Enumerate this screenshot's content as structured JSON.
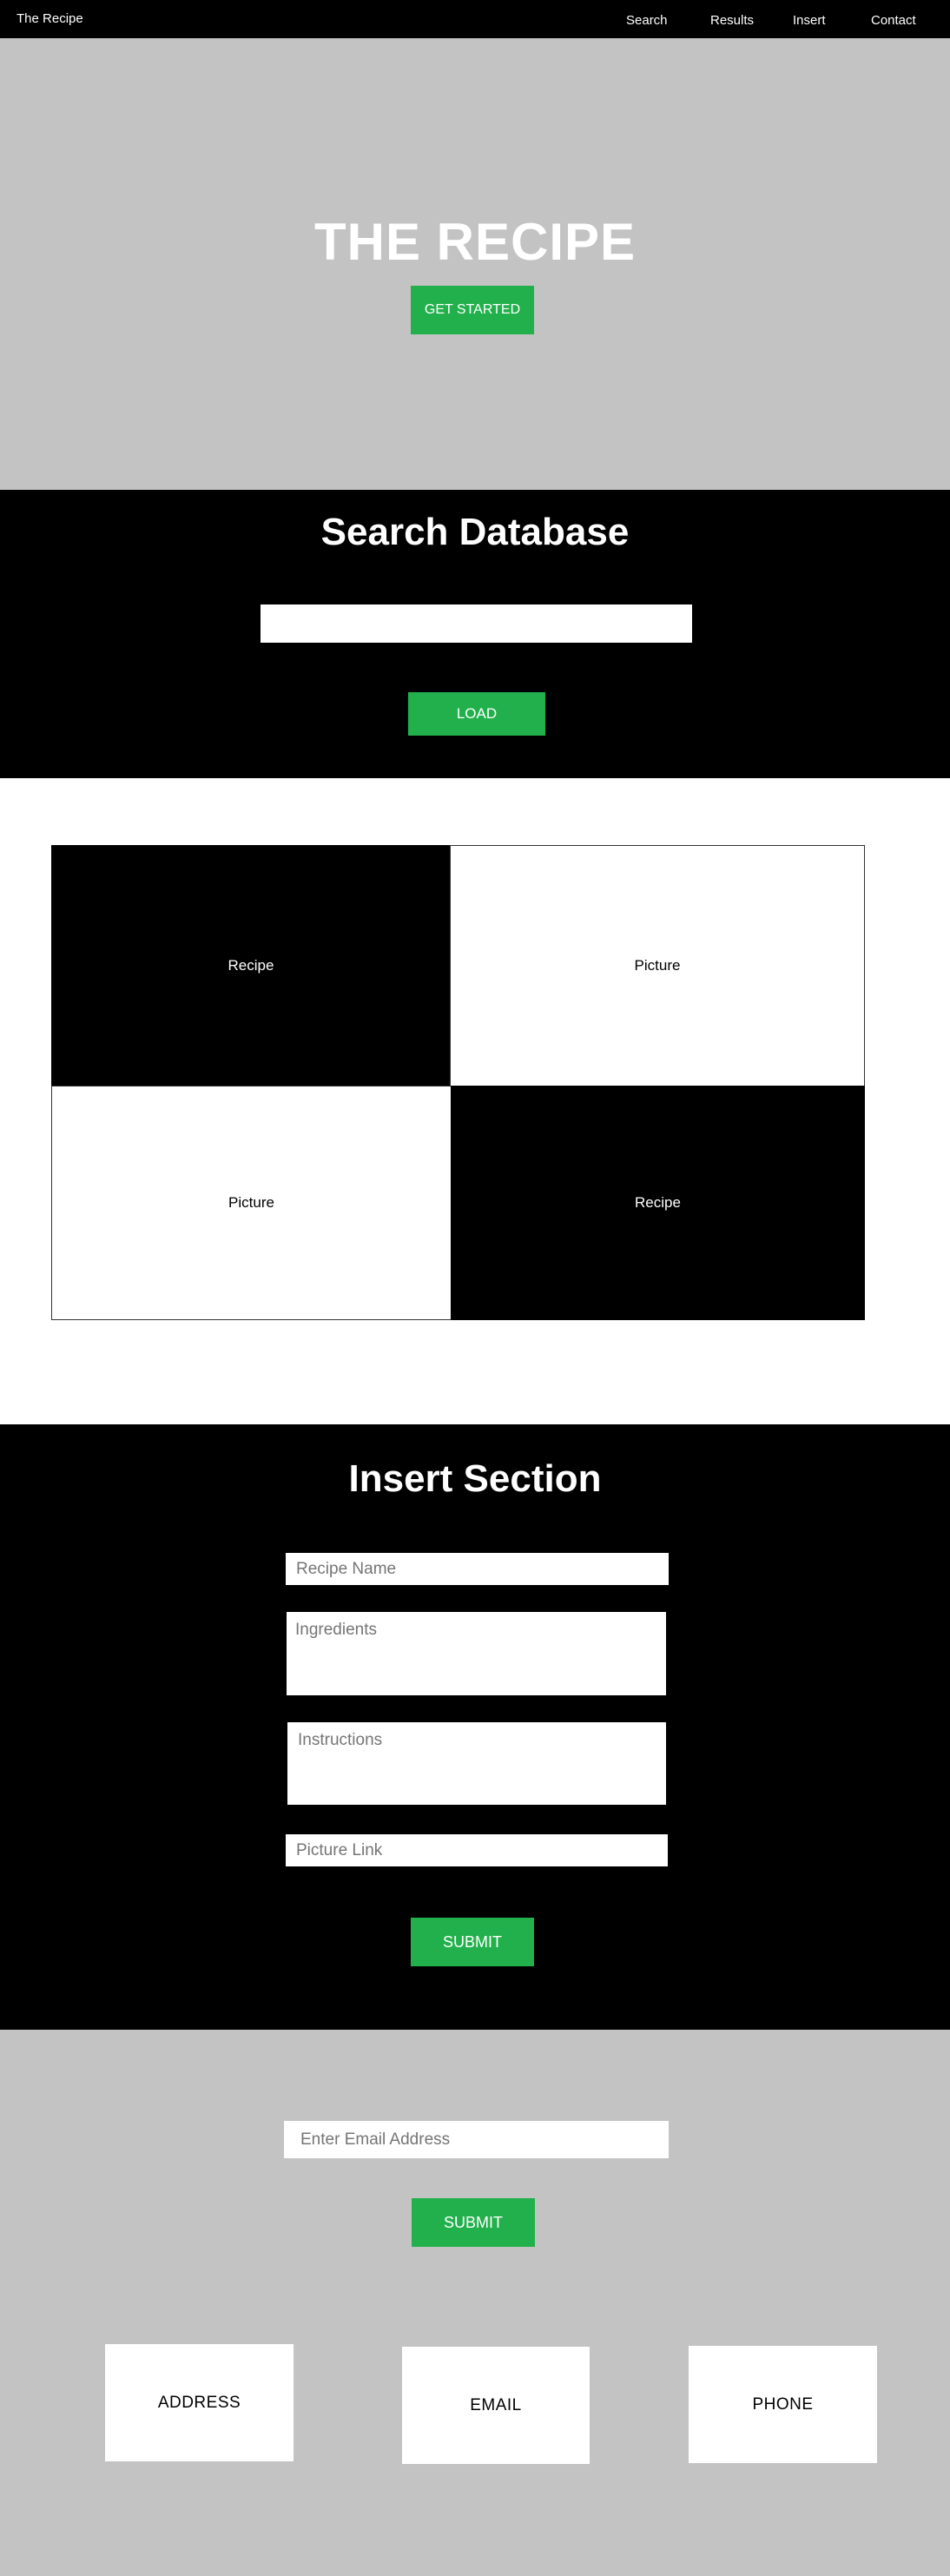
{
  "nav": {
    "brand": "The Recipe",
    "links": [
      "Search",
      "Results",
      "Insert",
      "Contact"
    ]
  },
  "hero": {
    "title": "THE RECIPE",
    "button": "GET STARTED"
  },
  "search": {
    "title": "Search Database",
    "input_value": "",
    "button": "LOAD"
  },
  "results": {
    "cells": [
      "Recipe",
      "Picture",
      "Picture",
      "Recipe"
    ]
  },
  "insert": {
    "title": "Insert Section",
    "recipe_name": "Recipe Name",
    "ingredients": "Ingredients",
    "instructions": "Instructions",
    "picture_link": "Picture Link",
    "submit": "SUBMIT"
  },
  "footer": {
    "email_placeholder": "Enter Email Address",
    "submit": "SUBMIT",
    "cards": [
      "ADDRESS",
      "EMAIL",
      "PHONE"
    ]
  },
  "colors": {
    "accent": "#21b04b",
    "gray": "#c3c3c3",
    "dark": "#000000"
  }
}
